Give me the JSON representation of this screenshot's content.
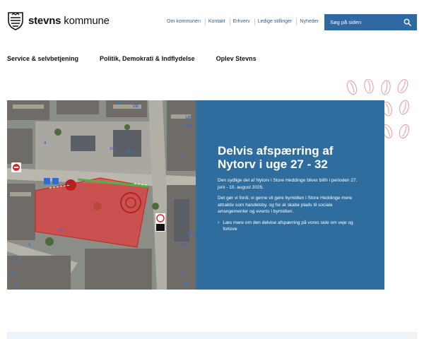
{
  "header": {
    "logo_bold": "stevns",
    "logo_regular": " kommune",
    "top_links": [
      "Om kommunen",
      "Kontakt",
      "Erhverv",
      "Ledige stillinger",
      "Nyheder"
    ],
    "search": {
      "placeholder": "Søg på siden",
      "icon": "search-icon"
    }
  },
  "main_nav": [
    "Service & selvbetjening",
    "Politik, Demokrati & Indflydelse",
    "Oplev Stevns"
  ],
  "hero": {
    "title": "Delvis afspærring af Nytorv i uge 27 - 32",
    "paragraphs": [
      "Den sydlige del af Nytorv i Store Heddinge bliver bilfri i perioden 27. juni - 10. august 2025.",
      "Det gør vi fordi, vi gerne vil gøre bymidten i Store Heddinge mere attraktiv som handelsby, og for at skabe plads til sociale arrangementer og events i bymidten."
    ],
    "link": {
      "chevron": "›",
      "text": "Læs mere om den delvise afspærring på vores side om veje og fortove"
    },
    "map_labels": [
      "2C",
      "2B",
      "1B",
      "12A",
      "2A",
      "1C",
      "4",
      "8",
      "5A",
      "3A",
      "1A",
      "8",
      "8",
      "10",
      "6A",
      "1",
      "3"
    ],
    "colors": {
      "panel": "#2f6d9f",
      "closed_area": "#e23b3b",
      "search_bar": "#2e6aa1"
    }
  }
}
